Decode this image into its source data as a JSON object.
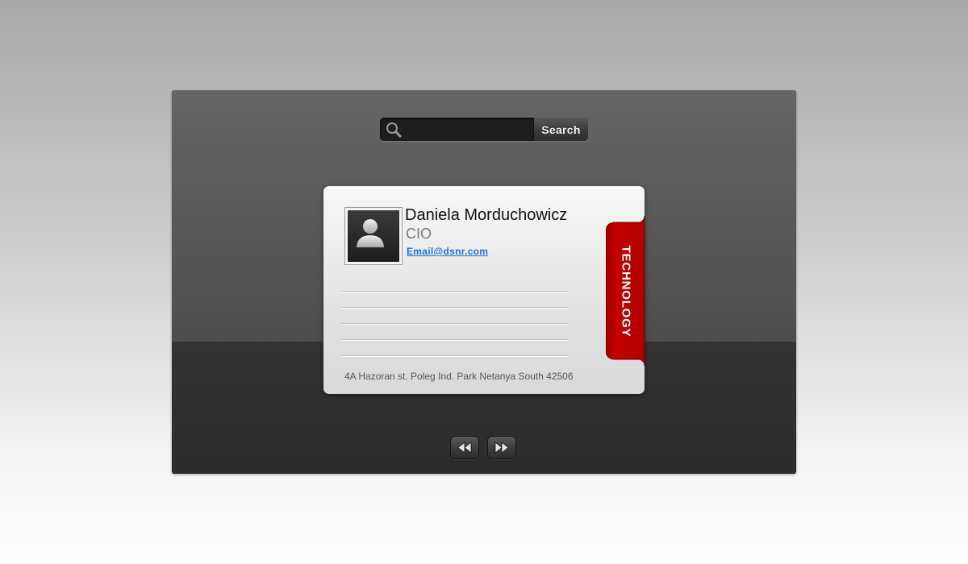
{
  "search": {
    "placeholder": "",
    "value": "",
    "button_label": "Search",
    "icon": "magnifier-icon"
  },
  "contact": {
    "name": "Daniela Morduchowicz",
    "title": "CIO",
    "email": "Email@dsnr.com",
    "address": "4A Hazoran st. Poleg Ind. Park Netanya South 42506",
    "avatar_icon": "user-silhouette-icon",
    "category": "TECHNOLOGY",
    "category_color": "#c00000"
  },
  "pager": {
    "prev_icon": "rewind-icon",
    "next_icon": "fast-forward-icon"
  }
}
